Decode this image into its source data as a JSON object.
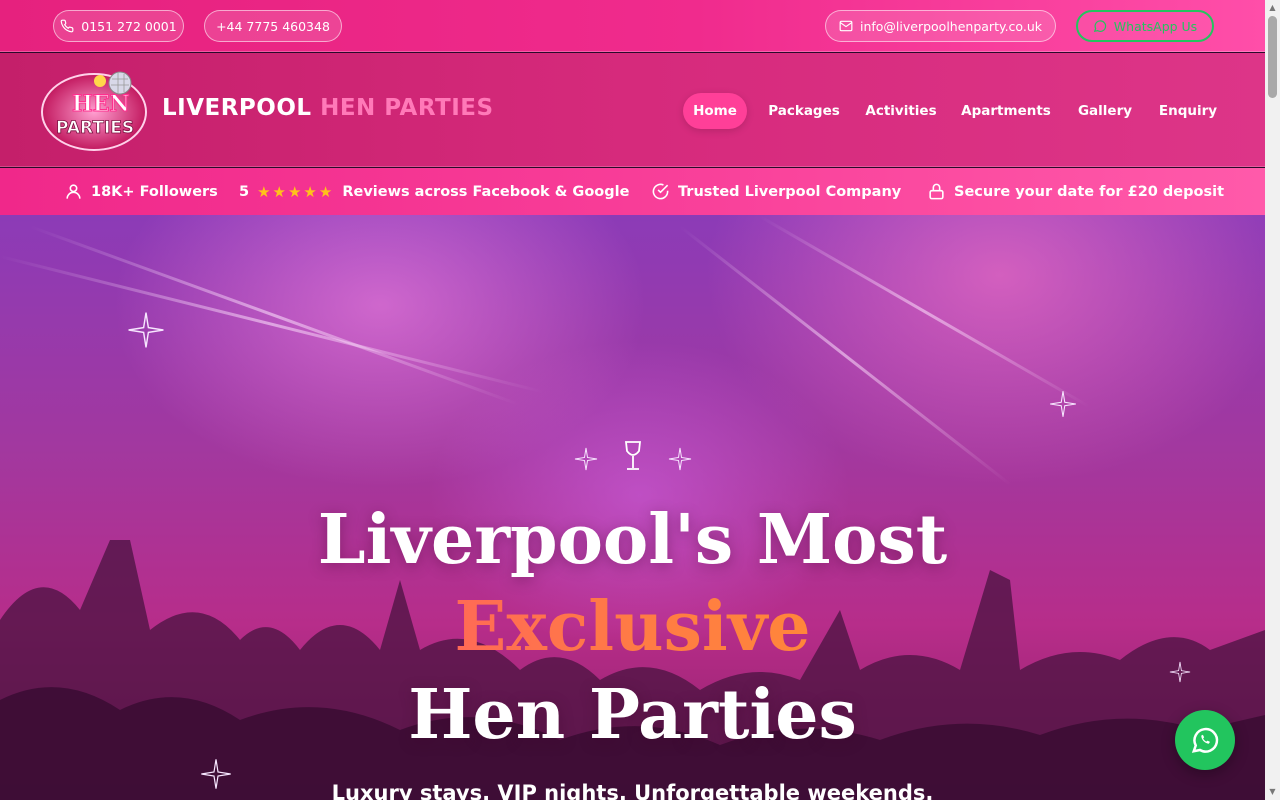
{
  "topbar": {
    "phone1": "0151 272 0001",
    "phone2": "+44 7775 460348",
    "email": "info@liverpoolhenparty.co.uk",
    "whatsapp": "WhatsApp Us"
  },
  "header": {
    "brand_white": "LIVERPOOL",
    "brand_pink": "HEN PARTIES",
    "logo_text_top": "HEN",
    "logo_text_bottom": "PARTIES",
    "nav": [
      {
        "label": "Home",
        "active": true
      },
      {
        "label": "Packages",
        "active": false
      },
      {
        "label": "Activities",
        "active": false
      },
      {
        "label": "Apartments",
        "active": false
      },
      {
        "label": "Gallery",
        "active": false
      },
      {
        "label": "Enquiry",
        "active": false
      }
    ]
  },
  "strip": {
    "followers": "18K+ Followers",
    "rating": "5",
    "stars": "★★★★★",
    "reviews": "Reviews across Facebook & Google",
    "trusted": "Trusted Liverpool Company",
    "deposit": "Secure your date for £20 deposit"
  },
  "hero": {
    "line1": "Liverpool's Most",
    "line2": "Exclusive",
    "line3": "Hen Parties",
    "subtitle": "Luxury stays. VIP nights. Unforgettable weekends."
  },
  "colors": {
    "brand_pink": "#f02b8d",
    "header_magenta": "#c41f6a",
    "accent_pink": "#ff79b8",
    "whatsapp_green": "#22c55e",
    "star_gold": "#ffc21a",
    "exclusive_gradient_start": "#ff3f7f",
    "exclusive_gradient_end": "#ffa21e"
  },
  "icons": {
    "phone": "phone-icon",
    "email": "mail-icon",
    "whatsapp": "whatsapp-icon",
    "user": "user-icon",
    "check": "check-circle-icon",
    "lock": "lock-icon",
    "wine": "wine-glass-icon",
    "sparkle": "sparkle-icon"
  }
}
